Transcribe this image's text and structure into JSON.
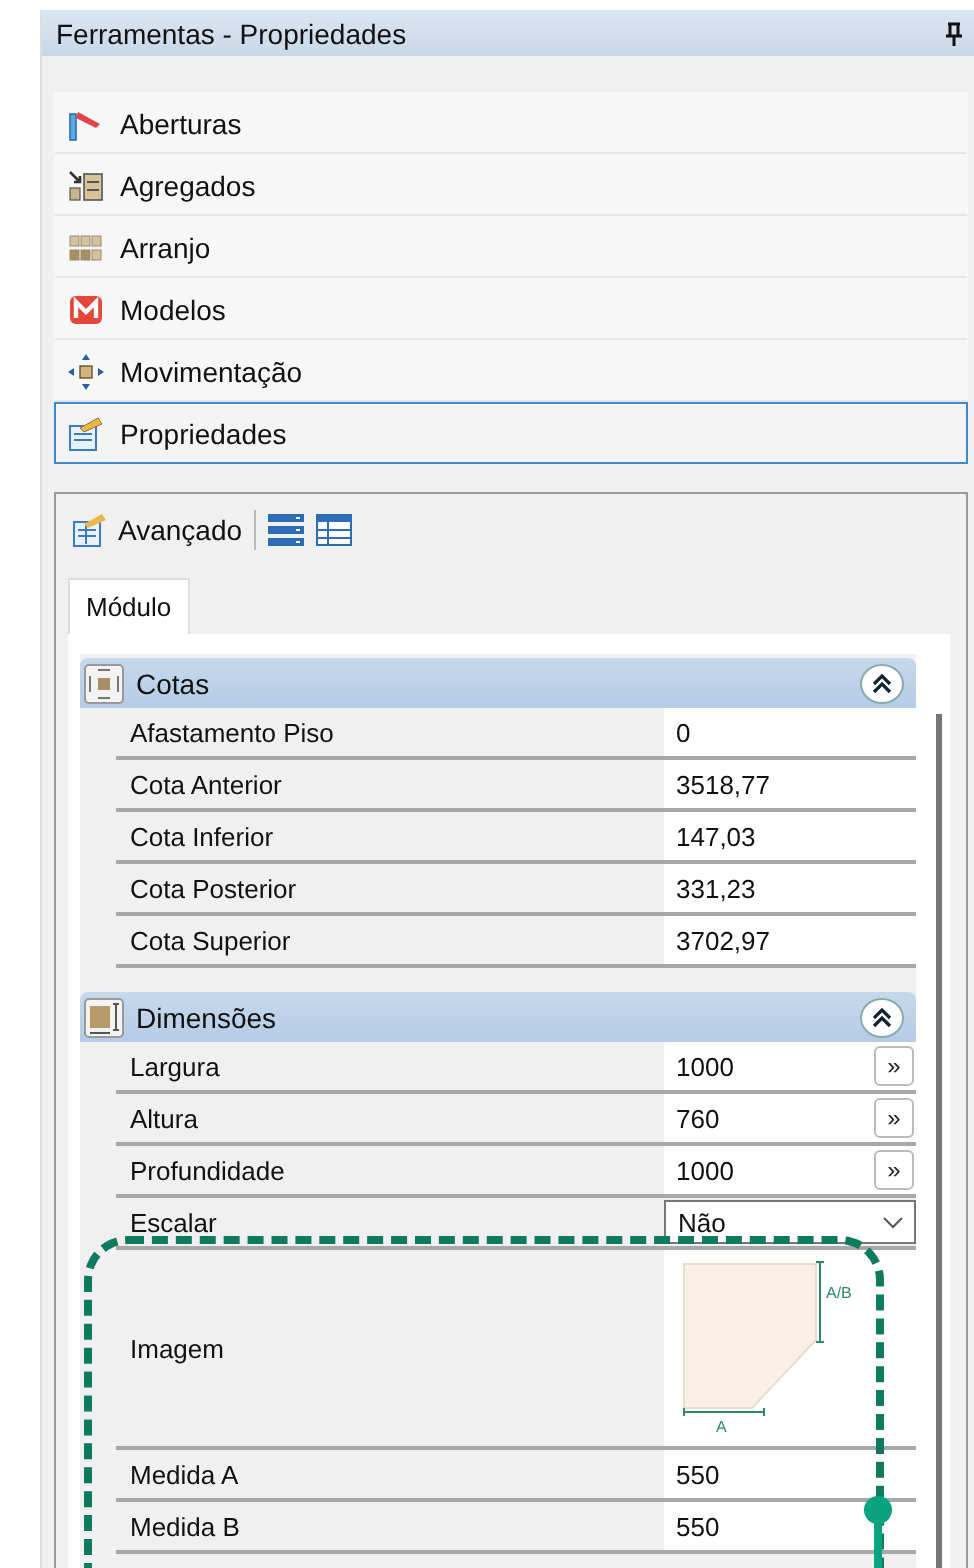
{
  "window": {
    "title": "Ferramentas - Propriedades"
  },
  "tools": [
    {
      "label": "Aberturas",
      "selected": false
    },
    {
      "label": "Agregados",
      "selected": false
    },
    {
      "label": "Arranjo",
      "selected": false
    },
    {
      "label": "Modelos",
      "selected": false
    },
    {
      "label": "Movimentação",
      "selected": false
    },
    {
      "label": "Propriedades",
      "selected": true
    }
  ],
  "toolbar": {
    "label": "Avançado"
  },
  "tabs": [
    {
      "label": "Módulo",
      "selected": true
    }
  ],
  "groups": [
    {
      "title": "Cotas",
      "expanded": true,
      "rows": [
        {
          "kind": "text",
          "label": "Afastamento Piso",
          "value": "0"
        },
        {
          "kind": "text",
          "label": "Cota Anterior",
          "value": "3518,77"
        },
        {
          "kind": "text",
          "label": "Cota Inferior",
          "value": "147,03"
        },
        {
          "kind": "text",
          "label": "Cota Posterior",
          "value": "331,23"
        },
        {
          "kind": "text",
          "label": "Cota Superior",
          "value": "3702,97"
        }
      ]
    },
    {
      "title": "Dimensões",
      "expanded": true,
      "rows": [
        {
          "kind": "button",
          "label": "Largura",
          "value": "1000",
          "button": "»"
        },
        {
          "kind": "button",
          "label": "Altura",
          "value": "760",
          "button": "»"
        },
        {
          "kind": "button",
          "label": "Profundidade",
          "value": "1000",
          "button": "»"
        },
        {
          "kind": "dropdown",
          "label": "Escalar",
          "value": "Não"
        },
        {
          "kind": "image",
          "label": "Imagem",
          "side_label": "A/B",
          "bottom_label": "A"
        },
        {
          "kind": "text",
          "label": "Medida A",
          "value": "550"
        },
        {
          "kind": "text",
          "label": "Medida B",
          "value": "550"
        }
      ]
    }
  ]
}
